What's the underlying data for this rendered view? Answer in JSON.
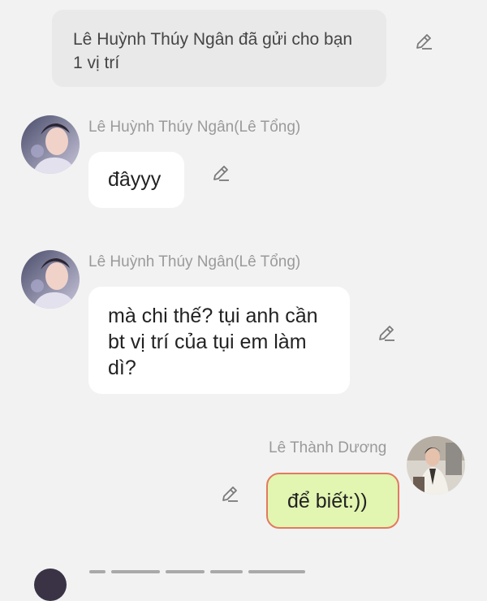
{
  "system_message": {
    "text": "Lê Huỳnh Thúy Ngân đã gửi cho bạn 1 vị trí"
  },
  "messages": [
    {
      "sender": "Lê Huỳnh Thúy Ngân(Lê Tổng)",
      "text": "đâyyy",
      "own": false
    },
    {
      "sender": "Lê Huỳnh Thúy Ngân(Lê Tổng)",
      "text": "mà chi thế? tụi anh cần bt vị trí của tụi em làm dì?",
      "own": false
    },
    {
      "sender": "Lê Thành Dương",
      "text": "để biết:))",
      "own": true
    }
  ],
  "icons": {
    "edit": "pencil-edit-icon",
    "avatar": "user-avatar"
  },
  "colors": {
    "background": "#f2f2f2",
    "system_card": "#e9e9e9",
    "incoming_bubble": "#ffffff",
    "outgoing_bubble": "#e2f5b1",
    "outgoing_border": "#e27a5e",
    "sender_name": "#9a9a9a"
  }
}
